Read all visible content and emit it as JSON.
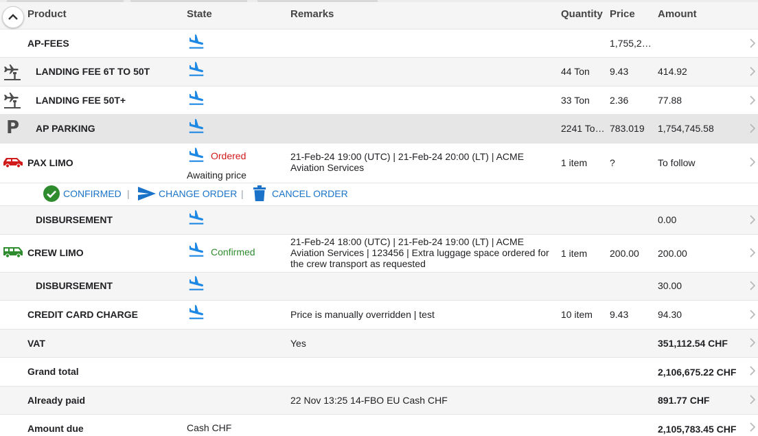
{
  "header": {
    "product": "Product",
    "state": "State",
    "remarks": "Remarks",
    "quantity": "Quantity",
    "price": "Price",
    "amount": "Amount"
  },
  "rows": [
    {
      "product": "AP-FEES",
      "state": "",
      "remarks": "",
      "quantity": "",
      "price": "1,755,2…",
      "amount": ""
    },
    {
      "product": "LANDING FEE 6T TO 50T",
      "state": "",
      "remarks": "",
      "quantity": "44 Ton",
      "price": "9.43",
      "amount": "414.92"
    },
    {
      "product": "LANDING FEE 50T+",
      "state": "",
      "remarks": "",
      "quantity": "33 Ton",
      "price": "2.36",
      "amount": "77.88"
    },
    {
      "product": "AP PARKING",
      "state": "",
      "remarks": "",
      "quantity": "2241 To…",
      "price": "783.019",
      "amount": "1,754,745.58"
    },
    {
      "product": "PAX LIMO",
      "state": "Ordered",
      "state_sub": "Awaiting price",
      "remarks": "21-Feb-24 19:00 (UTC) | 21-Feb-24 20:00 (LT) | ACME Aviation Services",
      "quantity": "1 item",
      "price": "?",
      "amount": "To follow"
    },
    {
      "product": "DISBURSEMENT",
      "state": "",
      "remarks": "",
      "quantity": "",
      "price": "",
      "amount": "0.00"
    },
    {
      "product": "CREW LIMO",
      "state": "Confirmed",
      "remarks": "21-Feb-24 18:00 (UTC) | 21-Feb-24 19:00 (LT) | ACME Aviation Services | 123456 | Extra luggage space ordered for the crew transport as requested",
      "quantity": "1 item",
      "price": "200.00",
      "amount": "200.00"
    },
    {
      "product": "DISBURSEMENT",
      "state": "",
      "remarks": "",
      "quantity": "",
      "price": "",
      "amount": "30.00"
    },
    {
      "product": "CREDIT CARD CHARGE",
      "state": "",
      "remarks": "Price is manually overridden | test",
      "quantity": "10 item",
      "price": "9.43",
      "amount": "94.30"
    }
  ],
  "actions": {
    "confirmed": "CONFIRMED",
    "change_order": "CHANGE ORDER",
    "cancel_order": "CANCEL ORDER",
    "separator": "|"
  },
  "totals": [
    {
      "label": "VAT",
      "state": "",
      "remarks": "Yes",
      "amount": "351,112.54 CHF"
    },
    {
      "label": "Grand total",
      "state": "",
      "remarks": "",
      "amount": "2,106,675.22 CHF"
    },
    {
      "label": "Already paid",
      "state": "",
      "remarks": "22 Nov 13:25 14-FBO EU Cash CHF",
      "amount": "891.77 CHF"
    },
    {
      "label": "Amount due",
      "state": "Cash CHF",
      "remarks": "",
      "amount": "2,105,783.45 CHF"
    }
  ],
  "colors": {
    "state_icon": "#1e88e5",
    "ordered": "#d11a1a",
    "confirmed": "#2e8b2e",
    "action_link": "#1a73c8",
    "pax_limo_car": "#d11a1a",
    "crew_limo_van": "#2e8b2e"
  },
  "icons": {
    "collapse": "chevron-up-icon",
    "state": "flight-landing-icon",
    "landing_fee": "airport-landing-icon",
    "parking": "parking-icon",
    "pax_limo": "car-icon",
    "crew_limo": "van-icon",
    "confirmed": "check-circle-icon",
    "change_order": "send-icon",
    "cancel_order": "trash-icon",
    "row_action": "chevron-right-icon"
  }
}
